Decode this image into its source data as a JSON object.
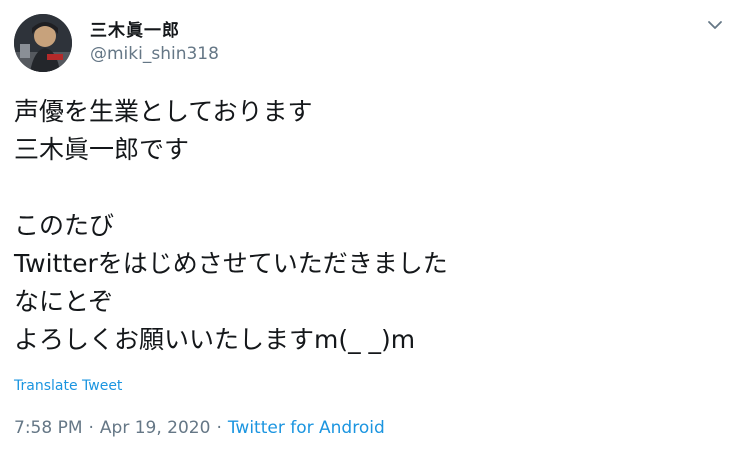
{
  "user": {
    "display_name": "三木眞一郎",
    "handle": "@miki_shin318"
  },
  "tweet": {
    "lines": [
      "声優を生業としております",
      "三木眞一郎です",
      "",
      "このたび",
      "Twitterをはじめさせていただきました",
      "なにとぞ",
      "よろしくお願いいたしますm(_ _)m"
    ],
    "translate_label": "Translate Tweet",
    "time": "7:58 PM",
    "date": "Apr 19, 2020",
    "source": "Twitter for Android"
  },
  "icons": {
    "menu": "chevron-down-icon",
    "avatar": "avatar"
  },
  "colors": {
    "text": "#14171a",
    "muted": "#657786",
    "link": "#1b95e0"
  }
}
